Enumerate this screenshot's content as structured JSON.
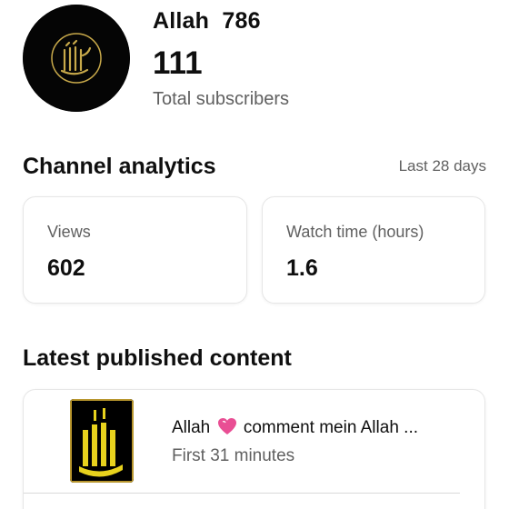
{
  "channel": {
    "name": "Allah  786",
    "subscriber_count": "111",
    "subscriber_label": "Total subscribers",
    "avatar_icon": "allah-calligraphy-icon"
  },
  "analytics": {
    "title": "Channel analytics",
    "period": "Last 28 days",
    "stats": [
      {
        "label": "Views",
        "value": "602"
      },
      {
        "label": "Watch time (hours)",
        "value": "1.6"
      }
    ]
  },
  "latest": {
    "title": "Latest published content",
    "items": [
      {
        "title_prefix": "Allah",
        "emoji_icon": "pink-heart-icon",
        "title_suffix": "comment mein Allah ...",
        "subtitle": "First 31 minutes",
        "thumbnail_icon": "allah-calligraphy-icon"
      }
    ]
  },
  "colors": {
    "text_primary": "#0f0f0f",
    "text_secondary": "#606060",
    "card_border": "#e6e6e6",
    "heart_pink": "#e94e94",
    "gold": "#c8a94a"
  }
}
